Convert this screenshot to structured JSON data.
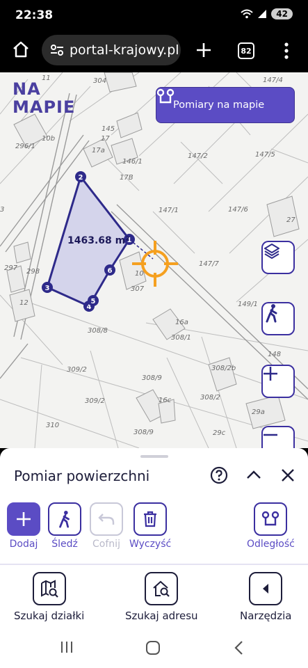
{
  "status": {
    "time": "22:38",
    "battery": "42"
  },
  "browser": {
    "url": "portal-krajowy.pl",
    "tab_count": "82"
  },
  "map": {
    "logo_line1": "NA",
    "logo_line2": "MAPIE",
    "measure_button_label": "Pomiary na mapie",
    "area_label": "1463.68 m²",
    "vertices": [
      "1",
      "2",
      "3",
      "4",
      "5",
      "6"
    ],
    "parcel_labels": [
      "11",
      "304",
      "147/4",
      "296/1",
      "10b",
      "145",
      "17",
      "17a",
      "146/1",
      "17B",
      "147/2",
      "147/5",
      "147/1",
      "147/6",
      "27",
      "297",
      "298",
      "12",
      "10",
      "307",
      "147/7",
      "149/1",
      "16a",
      "308/1",
      "308/8",
      "148",
      "309/2",
      "308/9",
      "308/2b",
      "16c",
      "308/2",
      "309/2",
      "29a",
      "310",
      "308/9",
      "29c",
      "3"
    ],
    "accent_color": "#5b4cc4",
    "target_color": "#f5a020"
  },
  "panel": {
    "title": "Pomiar powierzchni",
    "tools": [
      {
        "label": "Dodaj",
        "icon": "plus-icon"
      },
      {
        "label": "Śledź",
        "icon": "walking-person-icon"
      },
      {
        "label": "Cofnij",
        "icon": "undo-icon",
        "disabled": true
      },
      {
        "label": "Wyczyść",
        "icon": "trash-icon"
      },
      {
        "label": "Odległość",
        "icon": "distance-icon"
      }
    ],
    "nav": [
      {
        "label": "Szukaj działki",
        "icon": "map-search-icon"
      },
      {
        "label": "Szukaj adresu",
        "icon": "home-search-icon"
      },
      {
        "label": "Narzędzia",
        "icon": "chevron-left-icon"
      }
    ]
  }
}
